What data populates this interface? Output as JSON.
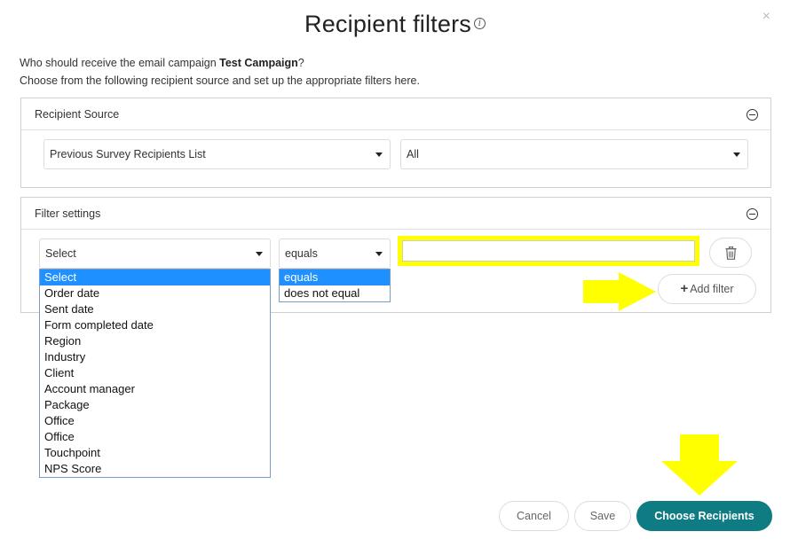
{
  "dialog": {
    "title": "Recipient filters",
    "info_icon": "info-icon",
    "close_label": "×",
    "intro_prefix": "Who should receive the email campaign ",
    "campaign_name": "Test Campaign",
    "intro_suffix": "?",
    "intro_line2": "Choose from the following recipient source and set up the appropriate filters here."
  },
  "recipient_source": {
    "heading": "Recipient Source",
    "source_select_value": "Previous Survey Recipients List",
    "scope_select_value": "All"
  },
  "filter_settings": {
    "heading": "Filter settings",
    "field_select_value": "Select",
    "operator_select_value": "equals",
    "value_input": "",
    "add_filter_label": "Add filter",
    "field_options": [
      "Select",
      "Order date",
      "Sent date",
      "Form completed date",
      "Region",
      "Industry",
      "Client",
      "Account manager",
      "Package",
      "Office",
      "Office",
      "Touchpoint",
      "NPS Score"
    ],
    "operator_options": [
      "equals",
      "does not equal"
    ]
  },
  "footer": {
    "cancel_label": "Cancel",
    "save_label": "Save",
    "choose_label": "Choose Recipients"
  },
  "colors": {
    "accent": "#0f7b83",
    "highlight": "#ffff00",
    "dropdown_selected": "#1e90ff"
  }
}
